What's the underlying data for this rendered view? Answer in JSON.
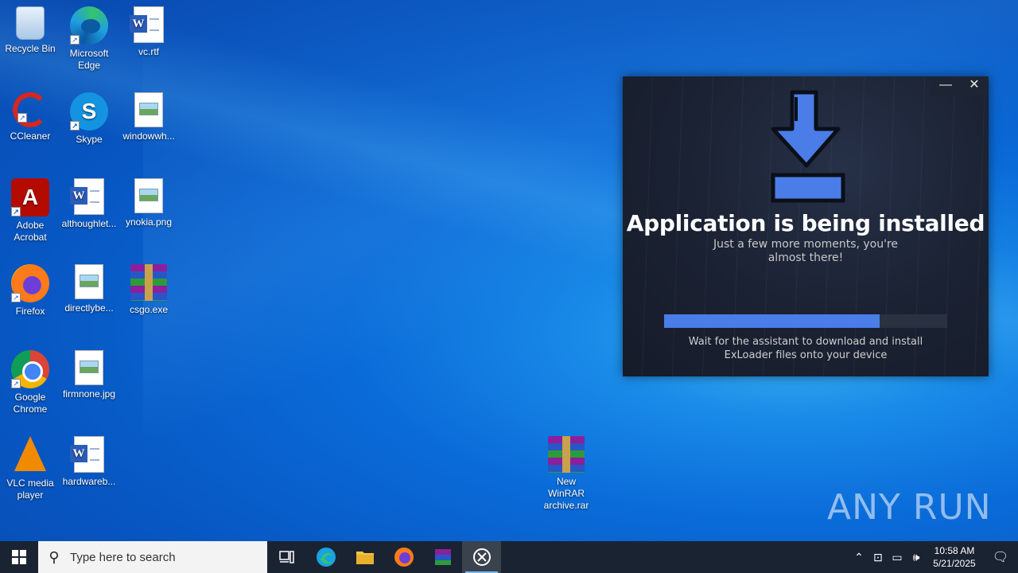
{
  "desktop": {
    "icons": [
      {
        "label": "Recycle Bin",
        "icon": "recycle-bin-icon"
      },
      {
        "label": "Microsoft Edge",
        "icon": "edge-icon"
      },
      {
        "label": "vc.rtf",
        "icon": "word-document-icon"
      },
      {
        "label": "CCleaner",
        "icon": "ccleaner-icon"
      },
      {
        "label": "Skype",
        "icon": "skype-icon"
      },
      {
        "label": "windowwh...",
        "icon": "image-file-icon"
      },
      {
        "label": "Adobe Acrobat",
        "icon": "adobe-acrobat-icon"
      },
      {
        "label": "althoughlet...",
        "icon": "word-document-icon"
      },
      {
        "label": "ynokia.png",
        "icon": "image-file-icon"
      },
      {
        "label": "Firefox",
        "icon": "firefox-icon"
      },
      {
        "label": "directlybe...",
        "icon": "image-file-icon"
      },
      {
        "label": "csgo.exe",
        "icon": "winrar-archive-icon"
      },
      {
        "label": "Google Chrome",
        "icon": "chrome-icon"
      },
      {
        "label": "firmnone.jpg",
        "icon": "image-file-icon"
      },
      {
        "label": "VLC media player",
        "icon": "vlc-icon"
      },
      {
        "label": "hardwareb...",
        "icon": "word-document-icon"
      },
      {
        "label": "New WinRAR archive.rar",
        "icon": "winrar-archive-icon"
      }
    ]
  },
  "installer": {
    "title": "Application is being installed",
    "subtitle": "Just a few more moments, you're almost there!",
    "progress": 0.76,
    "note": "Wait for the assistant to download and install ExLoader files onto your device",
    "minimize_glyph": "—",
    "close_glyph": "✕",
    "accent": "#4a7de8"
  },
  "watermark": "ANY RUN",
  "taskbar": {
    "search_placeholder": "Type here to search",
    "apps": [
      "task-view",
      "edge",
      "file-explorer",
      "firefox",
      "winrar",
      "exloader"
    ],
    "clock_time": "10:58 AM",
    "clock_date": "5/21/2025"
  }
}
